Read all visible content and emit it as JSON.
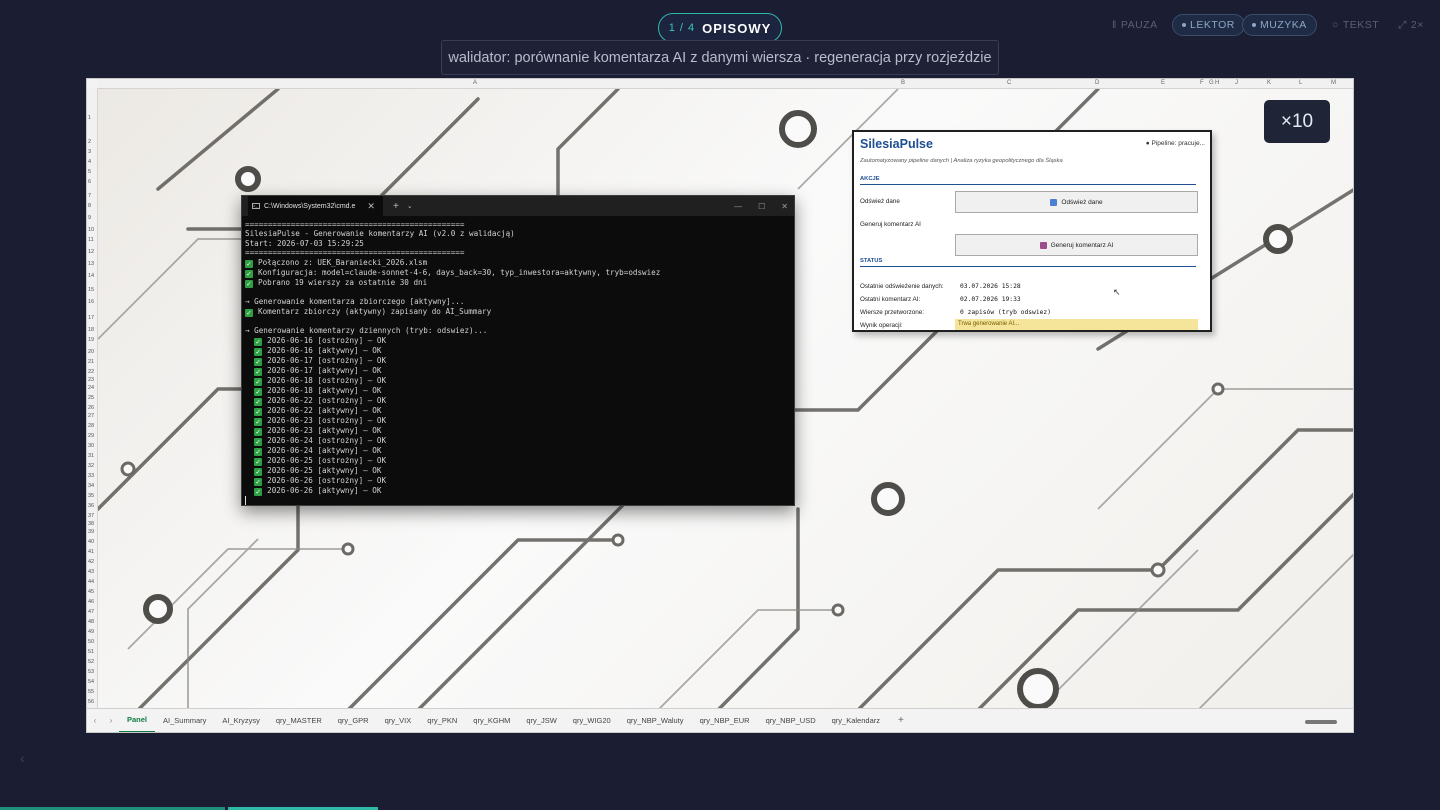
{
  "top": {
    "step_count": "1 / 4",
    "mode": "OPISOWY",
    "subtitle": "walidator: porównanie komentarza AI z danymi wiersza · regeneracja przy rozjeździe",
    "controls": [
      "PAUZA",
      "LEKTOR",
      "MUZYKA",
      "TEKST",
      "2×"
    ],
    "zoom": "×10"
  },
  "excel": {
    "columns": [
      "A",
      "B",
      "C",
      "D",
      "E",
      "F",
      "G",
      "H",
      "J",
      "K",
      "L",
      "M"
    ],
    "sheet_tabs": [
      "Panel",
      "AI_Summary",
      "AI_Kryzysy",
      "qry_MASTER",
      "qry_GPR",
      "qry_VIX",
      "qry_PKN",
      "qry_KGHM",
      "qry_JSW",
      "qry_WIG20",
      "qry_NBP_Waluty",
      "qry_NBP_EUR",
      "qry_NBP_USD",
      "qry_Kalendarz"
    ]
  },
  "cmd": {
    "tab_title": "C:\\Windows\\System32\\cmd.e",
    "separator": "================================================",
    "header": "SilesiaPulse - Generowanie komentarzy AI (v2.0 z walidacją)",
    "start": "Start: 2026-07-03 15:29:25",
    "connected": "Połączono z: UEK_Baraniecki_2026.xlsm",
    "config": "Konfiguracja: model=claude-sonnet-4-6, days_back=30, typ_inwestora=aktywny, tryb=odswiez",
    "fetched": "Pobrano 19 wierszy za ostatnie 30 dni",
    "gen_summary": "→ Generowanie komentarza zbiorczego [aktywny]...",
    "summary_saved": "Komentarz zbiorczy (aktywny) zapisany do AI_Summary",
    "gen_daily": "→ Generowanie komentarzy dziennych (tryb: odswiez)...",
    "daily": [
      "2026-06-16 [ostrożny] — OK",
      "2026-06-16 [aktywny] — OK",
      "2026-06-17 [ostrożny] — OK",
      "2026-06-17 [aktywny] — OK",
      "2026-06-18 [ostrożny] — OK",
      "2026-06-18 [aktywny] — OK",
      "2026-06-22 [ostrożny] — OK",
      "2026-06-22 [aktywny] — OK",
      "2026-06-23 [ostrożny] — OK",
      "2026-06-23 [aktywny] — OK",
      "2026-06-24 [ostrożny] — OK",
      "2026-06-24 [aktywny] — OK",
      "2026-06-25 [ostrożny] — OK",
      "2026-06-25 [aktywny] — OK",
      "2026-06-26 [ostrożny] — OK",
      "2026-06-26 [aktywny] — OK"
    ]
  },
  "panel": {
    "title": "SilesiaPulse",
    "pipeline": "● Pipeline: pracuje...",
    "tagline": "Zautomatyzowany pipeline danych | Analiza ryzyka geopolitycznego dla Śląska",
    "actions_header": "AKCJE",
    "refresh_label": "Odśwież dane",
    "refresh_button": "Odśwież dane",
    "generate_label": "Generuj komentarz AI",
    "generate_button": "Generuj komentarz AI",
    "status_header": "STATUS",
    "last_refresh_label": "Ostatnie odświeżenie danych:",
    "last_refresh_value": "03.07.2026 15:28",
    "last_comment_label": "Ostatni komentarz AI:",
    "last_comment_value": "02.07.2026 19:33",
    "rows_label": "Wiersze przetworzone:",
    "rows_value": "0 zapisów (tryb odswiez)",
    "result_label": "Wynik operacji:",
    "result_value": "Trwa generowanie AI..."
  },
  "colors": {
    "accent_teal": "#2fb9a8",
    "excel_green": "#107c41",
    "brand_blue": "#1d4f91",
    "check_green": "#2ea043",
    "status_yellow": "#f4e59b"
  }
}
